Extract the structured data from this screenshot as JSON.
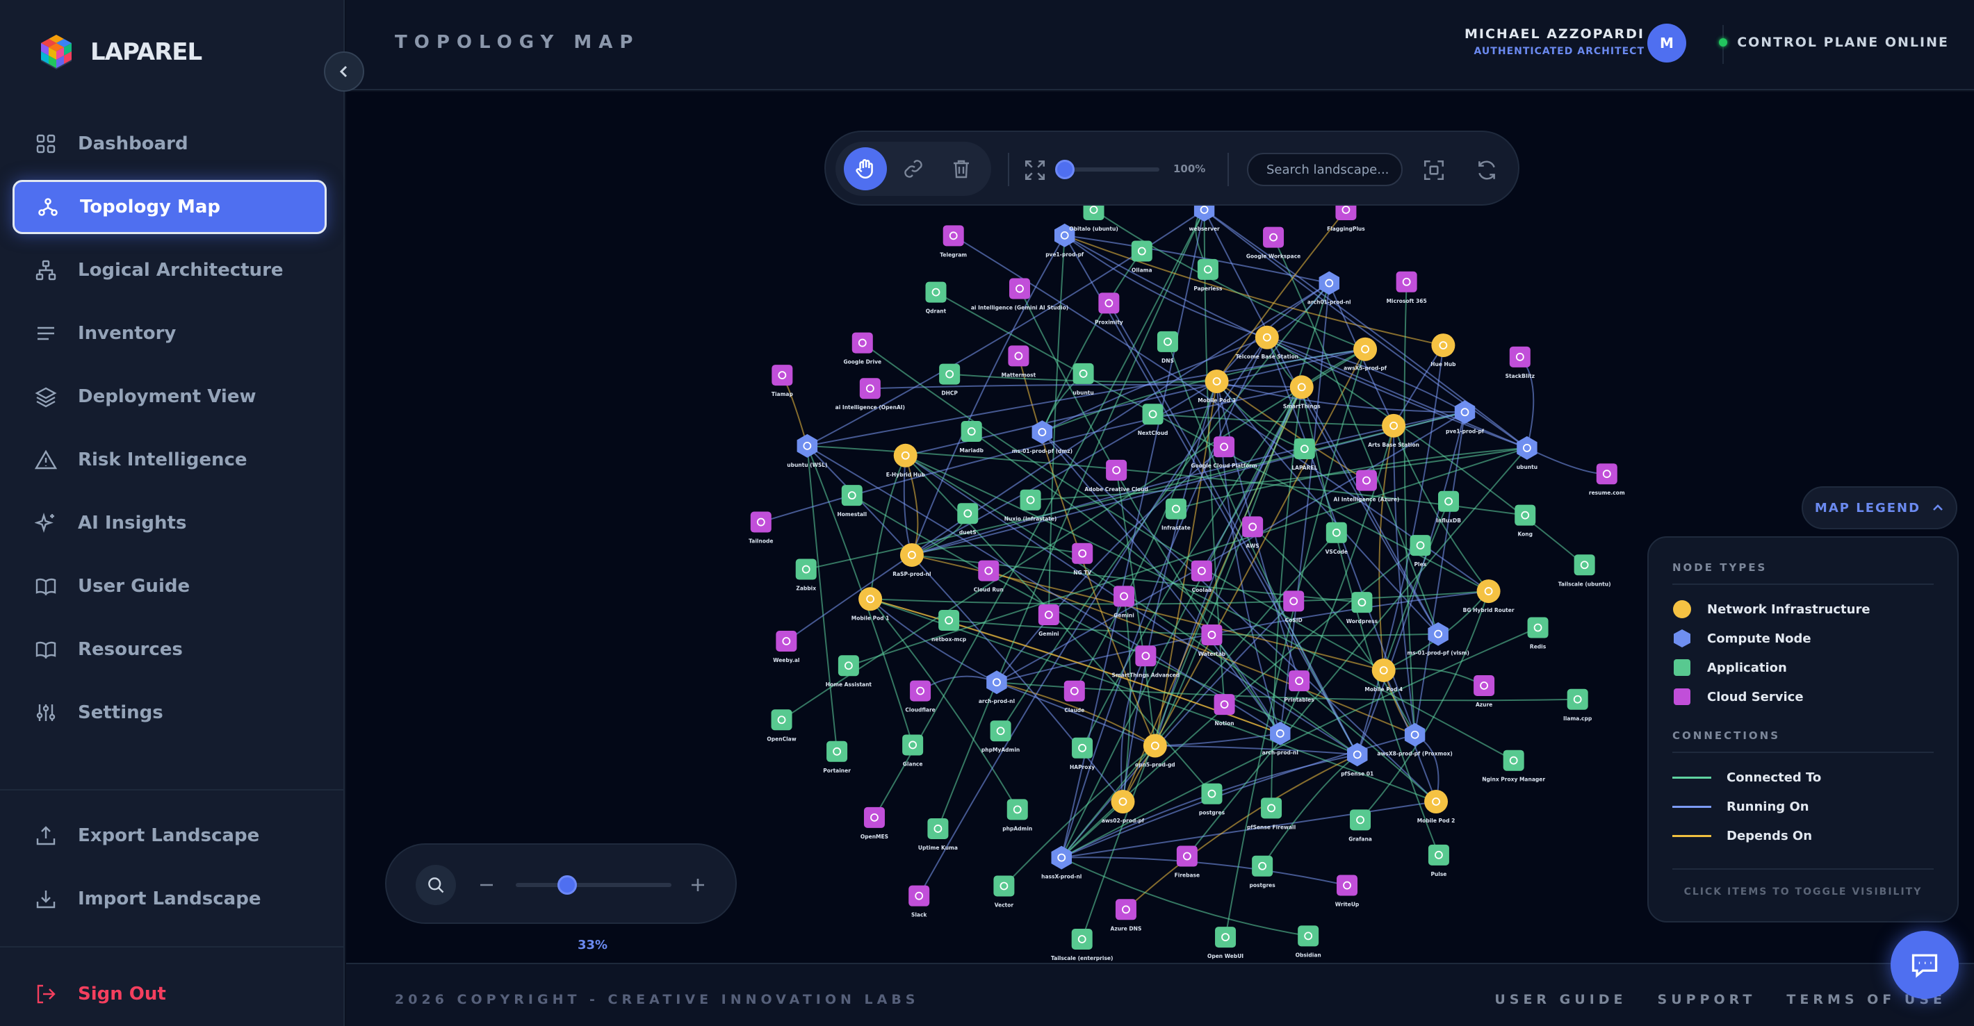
{
  "brand": {
    "name": "LAPAREL"
  },
  "sidebar": {
    "items": [
      {
        "label": "Dashboard",
        "icon": "grid-icon"
      },
      {
        "label": "Topology Map",
        "icon": "network-icon",
        "active": true
      },
      {
        "label": "Logical Architecture",
        "icon": "hierarchy-icon"
      },
      {
        "label": "Inventory",
        "icon": "list-icon"
      },
      {
        "label": "Deployment View",
        "icon": "layers-icon"
      },
      {
        "label": "Risk Intelligence",
        "icon": "warning-icon"
      },
      {
        "label": "AI Insights",
        "icon": "sparkle-icon"
      },
      {
        "label": "User Guide",
        "icon": "book-icon"
      },
      {
        "label": "Resources",
        "icon": "book-icon"
      },
      {
        "label": "Settings",
        "icon": "sliders-icon"
      }
    ],
    "bottom": [
      {
        "label": "Export Landscape",
        "icon": "upload-icon"
      },
      {
        "label": "Import Landscape",
        "icon": "download-icon"
      }
    ],
    "signout": "Sign Out"
  },
  "header": {
    "title": "TOPOLOGY MAP",
    "user_name": "MICHAEL AZZOPARDI",
    "user_role": "AUTHENTICATED ARCHITECT",
    "avatar": "M",
    "status": "CONTROL PLANE ONLINE"
  },
  "toolbar": {
    "zoom_value": "100%",
    "search_placeholder": "Search landscape..."
  },
  "zoom_panel": {
    "percent": "33%",
    "level": 0.33
  },
  "legend": {
    "toggle": "MAP LEGEND",
    "node_types_title": "NODE TYPES",
    "node_types": [
      {
        "label": "Network Infrastructure",
        "color": "#f5c243",
        "shape": "circle"
      },
      {
        "label": "Compute Node",
        "color": "#6f8ff0",
        "shape": "hexagon"
      },
      {
        "label": "Application",
        "color": "#58c990",
        "shape": "square"
      },
      {
        "label": "Cloud Service",
        "color": "#c14fd9",
        "shape": "square"
      }
    ],
    "connections_title": "CONNECTIONS",
    "connections": [
      {
        "label": "Connected To",
        "color": "#5fd3a0"
      },
      {
        "label": "Running On",
        "color": "#7c9bf5"
      },
      {
        "label": "Depends On",
        "color": "#f0c040"
      }
    ],
    "footer": "CLICK ITEMS TO TOGGLE VISIBILITY"
  },
  "footer": {
    "copyright": "2026 COPYRIGHT - CREATIVE INNOVATION LABS",
    "links": [
      "USER GUIDE",
      "SUPPORT",
      "TERMS OF USE"
    ]
  },
  "graph": {
    "colors": {
      "network": "#f5c243",
      "compute": "#6f8ff0",
      "application": "#58c990",
      "cloud": "#c14fd9"
    },
    "nodes": [
      {
        "id": "n1",
        "label": "Coolaa",
        "type": "cloud"
      },
      {
        "id": "n2",
        "label": "Gemini",
        "type": "cloud"
      },
      {
        "id": "n3",
        "label": "Infrastate",
        "type": "application"
      },
      {
        "id": "n4",
        "label": "Watertab",
        "type": "cloud"
      },
      {
        "id": "n5",
        "label": "NG TV",
        "type": "cloud"
      },
      {
        "id": "n6",
        "label": "AWS",
        "type": "cloud"
      },
      {
        "id": "n7",
        "label": "SmartThings Advanced",
        "type": "cloud"
      },
      {
        "id": "n8",
        "label": "Adobe Creative Cloud",
        "type": "cloud"
      },
      {
        "id": "n9",
        "label": "CoSID",
        "type": "cloud"
      },
      {
        "id": "n10",
        "label": "Gemini",
        "type": "cloud"
      },
      {
        "id": "n11",
        "label": "Google Cloud Platform",
        "type": "cloud"
      },
      {
        "id": "n12",
        "label": "Notion",
        "type": "cloud"
      },
      {
        "id": "n13",
        "label": "Nuxio (Infrastate)",
        "type": "application"
      },
      {
        "id": "n14",
        "label": "VSCode",
        "type": "application"
      },
      {
        "id": "n15",
        "label": "Claude",
        "type": "cloud"
      },
      {
        "id": "n16",
        "label": "NextCloud",
        "type": "application"
      },
      {
        "id": "n17",
        "label": "Printables",
        "type": "cloud"
      },
      {
        "id": "n18",
        "label": "Cloud Run",
        "type": "cloud"
      },
      {
        "id": "n19",
        "label": "LAPAREL",
        "type": "application"
      },
      {
        "id": "n20",
        "label": "opn5-prod-gd",
        "type": "network"
      },
      {
        "id": "n21",
        "label": "ms-01-prod-pf (dmz)",
        "type": "compute"
      },
      {
        "id": "n22",
        "label": "Wordpress",
        "type": "application"
      },
      {
        "id": "n23",
        "label": "arch-prod-nl",
        "type": "compute"
      },
      {
        "id": "n24",
        "label": "Mobile Pod 3",
        "type": "network"
      },
      {
        "id": "n25",
        "label": "arch-prod-nl",
        "type": "compute"
      },
      {
        "id": "n26",
        "label": "duetS",
        "type": "application"
      },
      {
        "id": "n27",
        "label": "AI Intelligence (Azure)",
        "type": "cloud"
      },
      {
        "id": "n28",
        "label": "HAProxy",
        "type": "application"
      },
      {
        "id": "n29",
        "label": "ubuntu",
        "type": "application"
      },
      {
        "id": "n30",
        "label": "Mobile Pod 4",
        "type": "network"
      },
      {
        "id": "n31",
        "label": "netbox-mcp",
        "type": "application"
      },
      {
        "id": "n32",
        "label": "SmartThings",
        "type": "network"
      },
      {
        "id": "n33",
        "label": "postgres",
        "type": "application"
      },
      {
        "id": "n34",
        "label": "Mariadb",
        "type": "application"
      },
      {
        "id": "n35",
        "label": "Plex",
        "type": "application"
      },
      {
        "id": "n36",
        "label": "phpMyAdmin",
        "type": "application"
      },
      {
        "id": "n37",
        "label": "DNS",
        "type": "application"
      },
      {
        "id": "n38",
        "label": "pfSense 01",
        "type": "compute"
      },
      {
        "id": "n39",
        "label": "RaSP-prod-nl",
        "type": "network"
      },
      {
        "id": "n40",
        "label": "Arts Base Station",
        "type": "network"
      },
      {
        "id": "n41",
        "label": "aws02-prod-pf",
        "type": "network"
      },
      {
        "id": "n42",
        "label": "Mattermost",
        "type": "cloud"
      },
      {
        "id": "n43",
        "label": "ms-01-prod-pf (vlsm)",
        "type": "compute"
      },
      {
        "id": "n44",
        "label": "Cloudflare",
        "type": "cloud"
      },
      {
        "id": "n45",
        "label": "Telcome Base Station",
        "type": "network"
      },
      {
        "id": "n46",
        "label": "pfSense Firewall",
        "type": "application"
      },
      {
        "id": "n47",
        "label": "E-Hybrid Hub",
        "type": "network"
      },
      {
        "id": "n48",
        "label": "InfluxDB",
        "type": "application"
      },
      {
        "id": "n49",
        "label": "phpAdmin",
        "type": "application"
      },
      {
        "id": "n50",
        "label": "Proximity",
        "type": "cloud"
      },
      {
        "id": "n51",
        "label": "awsX8-prod-pf (Proxmox)",
        "type": "compute"
      },
      {
        "id": "n52",
        "label": "Mobile Pod 1",
        "type": "network"
      },
      {
        "id": "n53",
        "label": "awsX5-prod-pf",
        "type": "network"
      },
      {
        "id": "n54",
        "label": "Firebase",
        "type": "cloud"
      },
      {
        "id": "n55",
        "label": "DHCP",
        "type": "application"
      },
      {
        "id": "n56",
        "label": "BG Hybrid Router",
        "type": "network"
      },
      {
        "id": "n57",
        "label": "Glance",
        "type": "application"
      },
      {
        "id": "n58",
        "label": "Paperless",
        "type": "application"
      },
      {
        "id": "n59",
        "label": "Grafana",
        "type": "application"
      },
      {
        "id": "n60",
        "label": "Homestall",
        "type": "application"
      },
      {
        "id": "n61",
        "label": "pve1-prod-pf",
        "type": "compute"
      },
      {
        "id": "n62",
        "label": "hassX-prod-nl",
        "type": "compute"
      },
      {
        "id": "n63",
        "label": "ai Intelligence (Gemini AI Studio)",
        "type": "cloud"
      },
      {
        "id": "n64",
        "label": "Azure",
        "type": "cloud"
      },
      {
        "id": "n65",
        "label": "Home Assistant",
        "type": "application"
      },
      {
        "id": "n66",
        "label": "arch01-prod-nl",
        "type": "compute"
      },
      {
        "id": "n67",
        "label": "postgres",
        "type": "application"
      },
      {
        "id": "n68",
        "label": "ai Intelligence (OpenAI)",
        "type": "cloud"
      },
      {
        "id": "n69",
        "label": "Kong",
        "type": "application"
      },
      {
        "id": "n70",
        "label": "Uptime Kuma",
        "type": "application"
      },
      {
        "id": "n71",
        "label": "Ollama",
        "type": "application"
      },
      {
        "id": "n72",
        "label": "Mobile Pod 2",
        "type": "network"
      },
      {
        "id": "n73",
        "label": "Zabbix",
        "type": "application"
      },
      {
        "id": "n74",
        "label": "Hue Hub",
        "type": "network"
      },
      {
        "id": "n75",
        "label": "Azure DNS",
        "type": "cloud"
      },
      {
        "id": "n76",
        "label": "Qdrant",
        "type": "application"
      },
      {
        "id": "n77",
        "label": "Redis",
        "type": "application"
      },
      {
        "id": "n78",
        "label": "Portainer",
        "type": "application"
      },
      {
        "id": "n79",
        "label": "Google Workspace",
        "type": "cloud"
      },
      {
        "id": "n80",
        "label": "WriteUp",
        "type": "cloud"
      },
      {
        "id": "n81",
        "label": "ubuntu (WSL)",
        "type": "compute"
      },
      {
        "id": "n82",
        "label": "ubuntu",
        "type": "compute"
      },
      {
        "id": "n83",
        "label": "Vector",
        "type": "application"
      },
      {
        "id": "n84",
        "label": "pve1-prod-pf",
        "type": "compute"
      },
      {
        "id": "n85",
        "label": "Nginx Proxy Manager",
        "type": "application"
      },
      {
        "id": "n86",
        "label": "Weeby.al",
        "type": "cloud"
      },
      {
        "id": "n87",
        "label": "Microsoft 365",
        "type": "cloud"
      },
      {
        "id": "n88",
        "label": "Open WebUI",
        "type": "application"
      },
      {
        "id": "n89",
        "label": "Google Drive",
        "type": "cloud"
      },
      {
        "id": "n90",
        "label": "Tailscale (ubuntu)",
        "type": "application"
      },
      {
        "id": "n91",
        "label": "OpenMES",
        "type": "cloud"
      },
      {
        "id": "n92",
        "label": "webserver",
        "type": "compute"
      },
      {
        "id": "n93",
        "label": "Pulse",
        "type": "application"
      },
      {
        "id": "n94",
        "label": "Tailnode",
        "type": "cloud"
      },
      {
        "id": "n95",
        "label": "StackBlitz",
        "type": "cloud"
      },
      {
        "id": "n96",
        "label": "Tailscale (enterprise)",
        "type": "application"
      },
      {
        "id": "n97",
        "label": "Telegram",
        "type": "cloud"
      },
      {
        "id": "n98",
        "label": "llama.cpp",
        "type": "application"
      },
      {
        "id": "n99",
        "label": "OpenClaw",
        "type": "application"
      },
      {
        "id": "n100",
        "label": "FlaggingPlus",
        "type": "cloud"
      },
      {
        "id": "n101",
        "label": "Obsidian",
        "type": "application"
      },
      {
        "id": "n102",
        "label": "Tiamap",
        "type": "cloud"
      },
      {
        "id": "n103",
        "label": "resume.com",
        "type": "cloud"
      },
      {
        "id": "n104",
        "label": "Slack",
        "type": "cloud"
      },
      {
        "id": "n105",
        "label": "Obitalo (ubuntu)",
        "type": "application"
      }
    ]
  }
}
